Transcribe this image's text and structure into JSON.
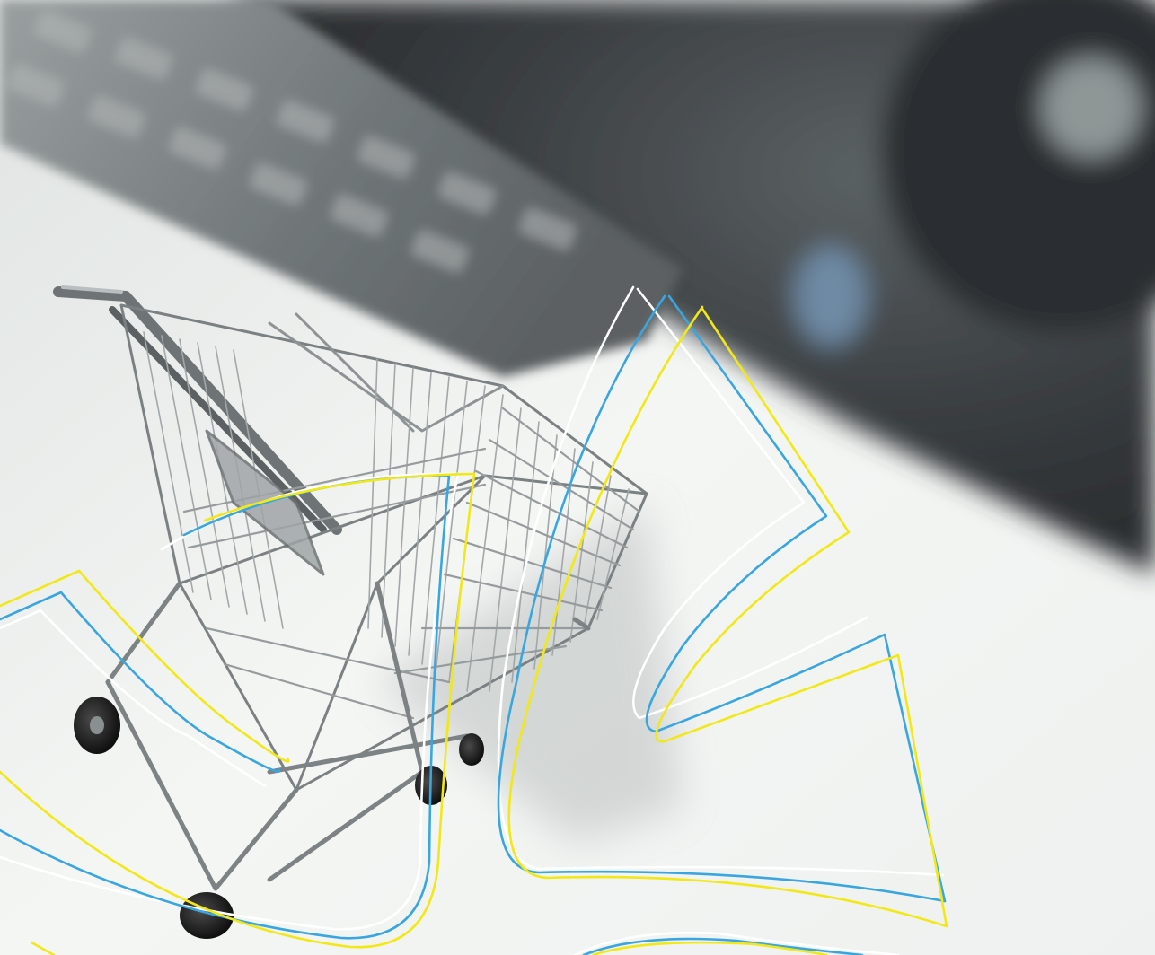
{
  "scene": {
    "subject": "shopping-cart",
    "background": "blurred-computer-keyboard-and-monitor",
    "tone": "monochrome-grey"
  },
  "colors": {
    "background_light": "#f1f3f1",
    "keyboard_grey": "#7f8587",
    "monitor_dark": "#3b3f42",
    "cart_metal": "#8f9496",
    "wheel_black": "#1c1c1c",
    "accent_white": "#ffffff",
    "accent_blue": "#3aa6df",
    "accent_yellow": "#f2e817"
  },
  "decorative_lines": [
    {
      "name": "white-swoosh",
      "color": "#ffffff"
    },
    {
      "name": "blue-swoosh",
      "color": "#3aa6df"
    },
    {
      "name": "yellow-swoosh",
      "color": "#f2e817"
    }
  ]
}
